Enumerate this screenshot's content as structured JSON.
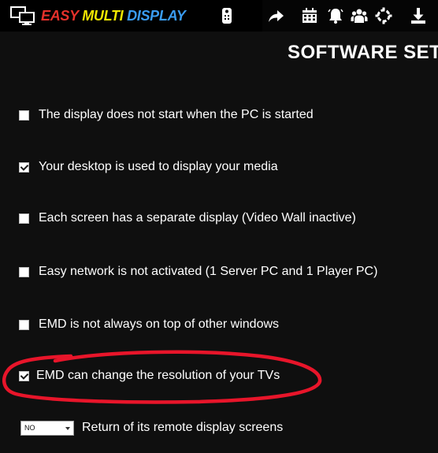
{
  "app": {
    "brand_easy": "EASY",
    "brand_multi": "MULTI",
    "brand_display": "DISPLAY",
    "brand_colors": {
      "easy": "#e5312b",
      "multi": "#f0e600",
      "display": "#3a9cf0"
    }
  },
  "toolbar": {
    "icons": [
      "monitors-logo-icon",
      "remote-control-icon",
      "share-arrow-icon",
      "calendar-icon",
      "alarm-bell-icon",
      "users-group-icon",
      "settings-ring-icon",
      "download-icon"
    ]
  },
  "page": {
    "title": "SOFTWARE SET"
  },
  "settings": [
    {
      "checked": false,
      "label": "The display does not start when the PC is started"
    },
    {
      "checked": true,
      "label": "Your desktop is used to display your media"
    },
    {
      "checked": false,
      "label": "Each screen has a separate display (Video Wall inactive)"
    },
    {
      "checked": false,
      "label": "Easy network is not activated (1 Server PC and 1 Player PC)"
    },
    {
      "checked": false,
      "label": "EMD is not always on top of other windows"
    },
    {
      "checked": true,
      "label": "EMD can change the resolution of your TVs",
      "highlighted": true
    }
  ],
  "remote_display": {
    "select_value": "NO",
    "label": "Return of its remote display screens"
  },
  "colors": {
    "background": "#0f0f0f",
    "topbar": "#050505",
    "highlight": "#e8152a"
  }
}
